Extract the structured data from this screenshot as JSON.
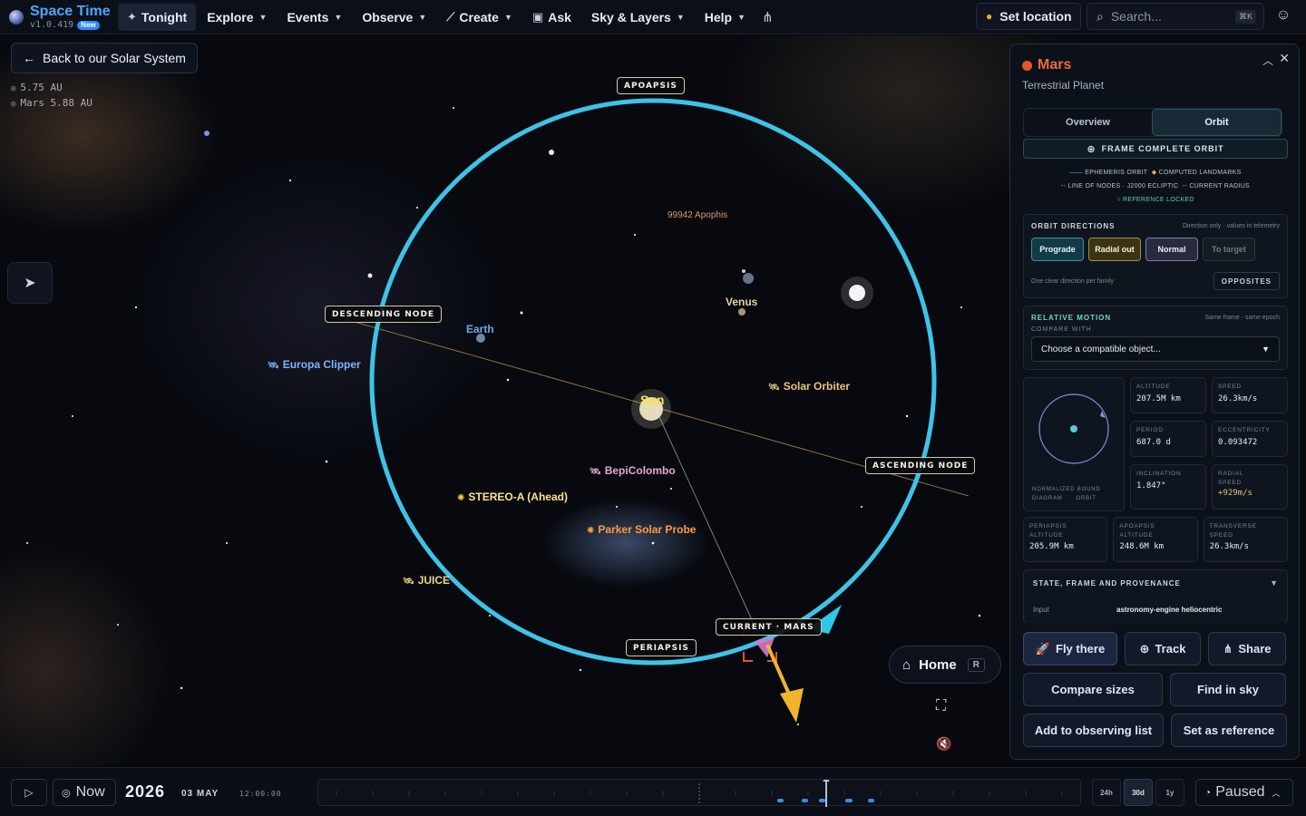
{
  "brand": {
    "name": "Space Time",
    "version": "v1.0.419",
    "badge": "New"
  },
  "nav": {
    "tonight": "Tonight",
    "explore": "Explore",
    "events": "Events",
    "observe": "Observe",
    "create": "Create",
    "ask": "Ask",
    "sky_layers": "Sky & Layers",
    "help": "Help"
  },
  "header_right": {
    "set_location": "Set location",
    "search_placeholder": "Search...",
    "search_shortcut": "⌘K"
  },
  "view": {
    "back_label": "Back to our Solar System",
    "dist_sun": "5.75 AU",
    "dist_mars": "Mars 5.88 AU",
    "orbit_tags": {
      "apoapsis": "APOAPSIS",
      "periapsis": "PERIAPSIS",
      "descending": "DESCENDING NODE",
      "ascending": "ASCENDING NODE",
      "current": "CURRENT · MARS"
    },
    "bodies": {
      "sun": "Sun",
      "earth": "Earth",
      "venus": "Venus",
      "apophis": "99942 Apophis",
      "europa": "Europa Clipper",
      "solar_orbiter": "Solar Orbiter",
      "bepicolombo": "BepiColombo",
      "stereo": "STEREO-A (Ahead)",
      "parker": "Parker Solar Probe",
      "juice": "JUICE"
    },
    "home_label": "Home",
    "home_key": "R"
  },
  "panel": {
    "title": "Mars",
    "subtitle": "Terrestrial Planet",
    "tabs": {
      "overview": "Overview",
      "orbit": "Orbit"
    },
    "frame_btn": "FRAME COMPLETE ORBIT",
    "legend": {
      "ephemeris": "EPHEMERIS ORBIT",
      "landmarks": "COMPUTED LANDMARKS",
      "nodes": "LINE OF NODES · J2000 ECLIPTIC",
      "radius": "CURRENT RADIUS",
      "locked": "REFERENCE LOCKED"
    },
    "directions": {
      "title": "ORBIT DIRECTIONS",
      "note": "Direction only · values in telemetry",
      "prograde": "Prograde",
      "radial_out": "Radial out",
      "normal": "Normal",
      "to_target": "To target",
      "foot_note": "One clear direction per family",
      "opposites": "OPPOSITES"
    },
    "relative": {
      "title": "RELATIVE MOTION",
      "note": "Same frame · same epoch",
      "compare_label": "COMPARE WITH",
      "select_value": "Choose a compatible object..."
    },
    "diagram_caption_1": "NORMALIZED BOUND",
    "diagram_caption_2": "DIAGRAM      ORBIT",
    "stats": {
      "altitude_k": "ALTITUDE",
      "altitude_v": "207.5M km",
      "speed_k": "SPEED",
      "speed_v": "26.3km/s",
      "period_k": "PERIOD",
      "period_v": "687.0 d",
      "ecc_k": "ECCENTRICITY",
      "ecc_v": "0.093472",
      "incl_k": "INCLINATION",
      "incl_v": "1.847°",
      "radial_k1": "RADIAL",
      "radial_k2": "SPEED",
      "radial_v": "+929m/s",
      "peri_k1": "PERIAPSIS",
      "peri_k2": "ALTITUDE",
      "peri_v": "205.9M km",
      "apo_k1": "APOAPSIS",
      "apo_k2": "ALTITUDE",
      "apo_v": "248.6M km",
      "trans_k1": "TRANSVERSE",
      "trans_k2": "SPEED",
      "trans_v": "26.3km/s"
    },
    "provenance": {
      "title": "STATE, FRAME AND PROVENANCE",
      "input_k": "Input",
      "input_v": "astronomy-engine heliocentric"
    },
    "actions": {
      "fly": "Fly there",
      "track": "Track",
      "share": "Share",
      "compare": "Compare sizes",
      "find": "Find in sky",
      "observing": "Add to observing list",
      "reference": "Set as reference"
    }
  },
  "bottom": {
    "now": "Now",
    "year": "2026",
    "date": "03 MAY",
    "time": "12:00:00",
    "scale_24h": "24h",
    "scale_30d": "30d",
    "scale_1y": "1y",
    "paused": "Paused"
  },
  "colors": {
    "accent": "#4aa8ff",
    "orbit": "#3ec3e6",
    "mars": "#e3552a",
    "node_line": "#b08a45"
  }
}
